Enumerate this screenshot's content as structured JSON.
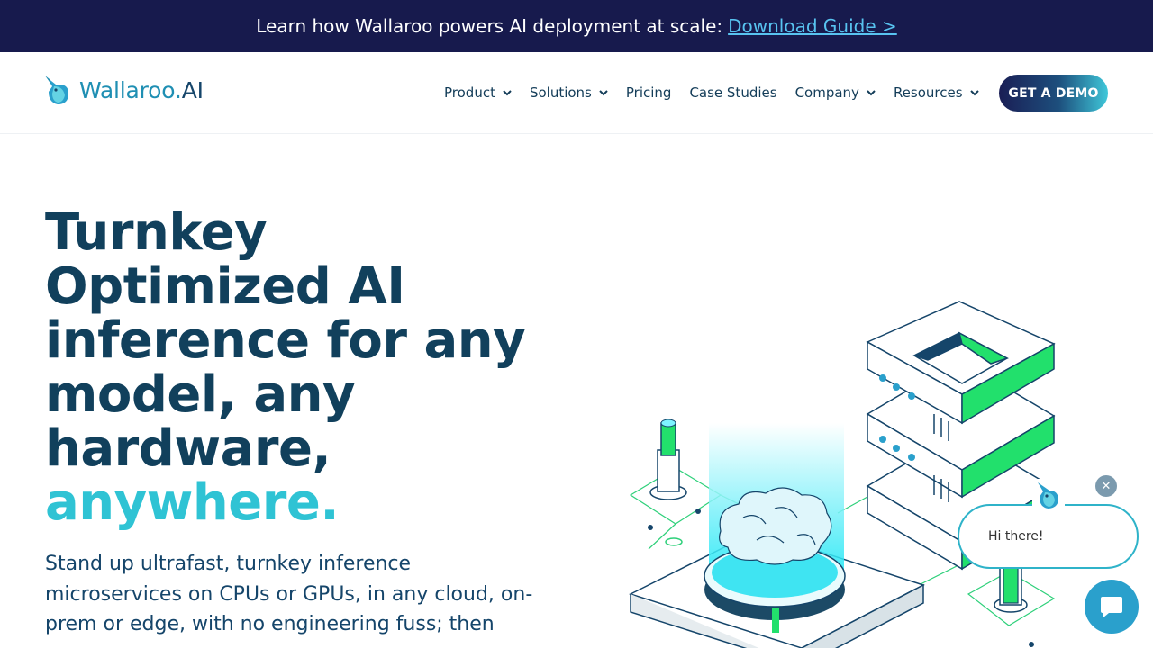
{
  "banner": {
    "text": "Learn how Wallaroo powers AI deployment at scale:",
    "link": "Download Guide >"
  },
  "logo": {
    "brand": "Wallaroo.",
    "suffix": "AI"
  },
  "nav": [
    {
      "label": "Product",
      "dropdown": true
    },
    {
      "label": "Solutions",
      "dropdown": true
    },
    {
      "label": "Pricing",
      "dropdown": false
    },
    {
      "label": "Case Studies",
      "dropdown": false
    },
    {
      "label": "Company",
      "dropdown": true
    },
    {
      "label": "Resources",
      "dropdown": true
    }
  ],
  "cta": {
    "label": "GET A DEMO"
  },
  "hero": {
    "title_lines": [
      "Turnkey",
      "Optimized AI",
      "inference for any",
      "model, any",
      "hardware,"
    ],
    "title_accent": "anywhere.",
    "subtitle": "Stand up ultrafast, turnkey inference microservices on CPUs or GPUs, in any cloud, on-prem or edge, with no engineering fuss; then"
  },
  "chat": {
    "greeting": "Hi there!",
    "close_icon": "close-icon",
    "launcher_icon": "chat-bubble-icon"
  },
  "colors": {
    "banner_bg": "#171a4d",
    "link": "#58c3f0",
    "heading": "#11405c",
    "accent": "#2fc3d4",
    "green": "#22e06c"
  }
}
